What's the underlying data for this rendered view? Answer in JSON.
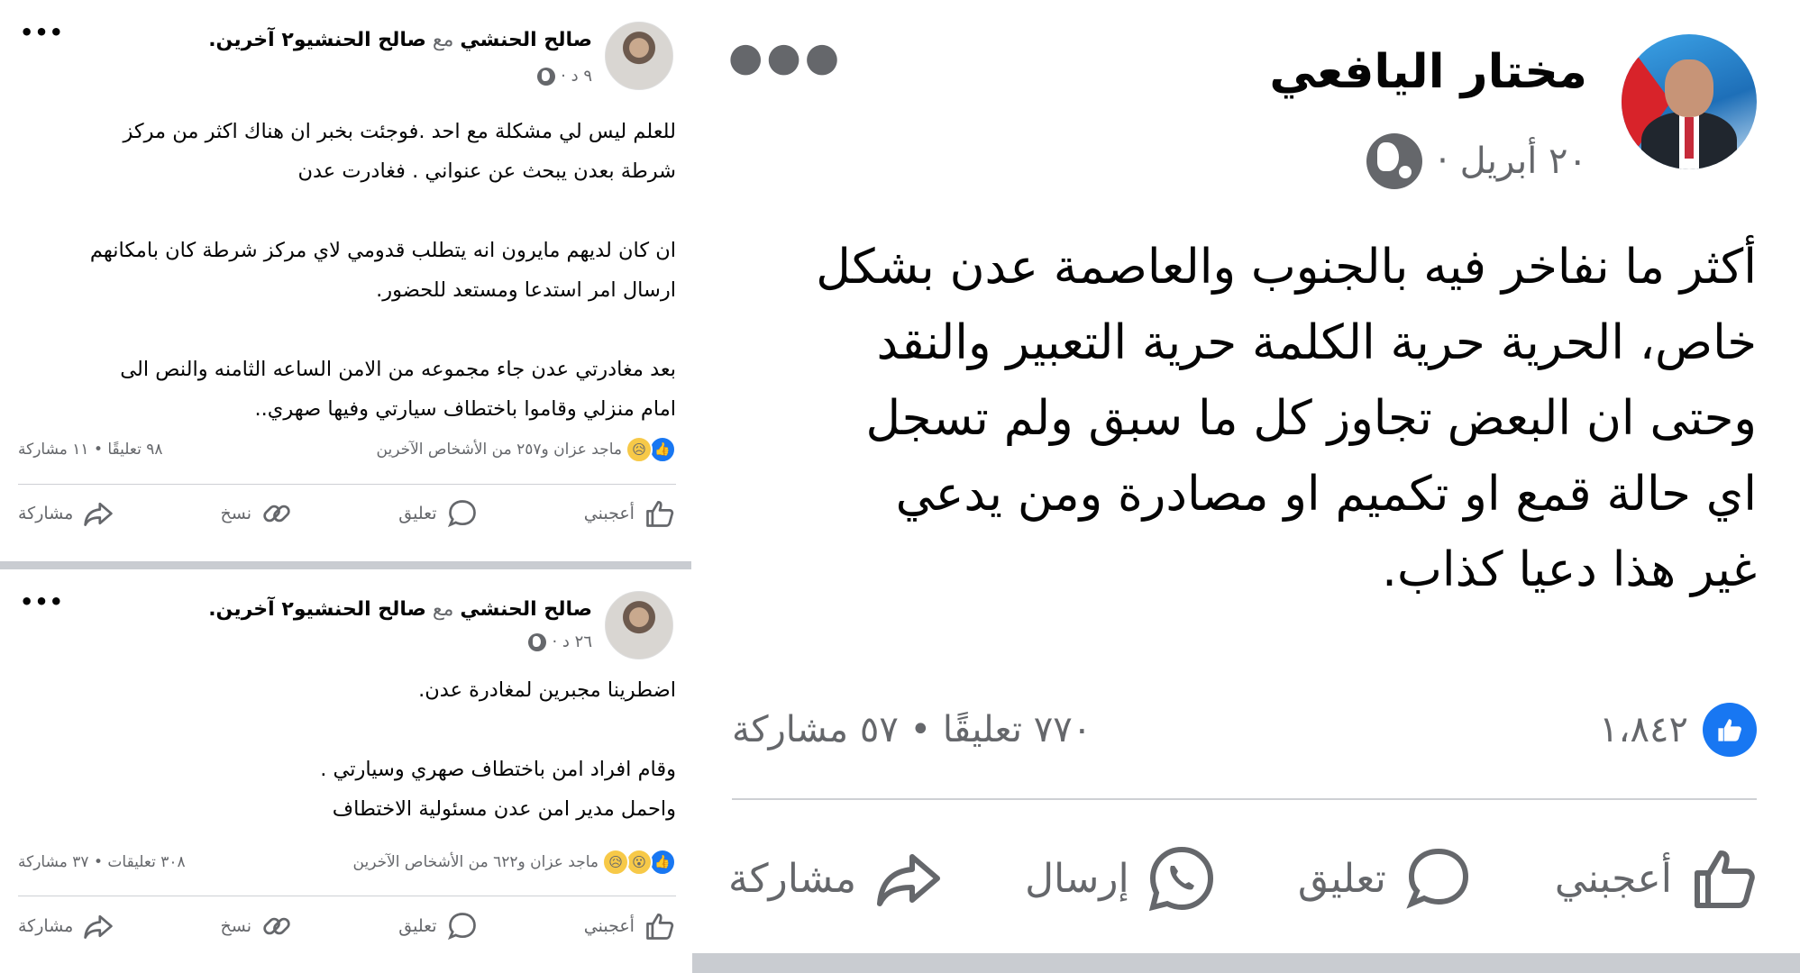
{
  "posts": [
    {
      "author": "صالح الحنشي",
      "with_word": "مع",
      "tagged": "صالح الحنشي",
      "and_others": "و٢ آخرين.",
      "time": "٩ د ·",
      "body": "للعلم ليس لي مشكلة مع احد .فوجئت بخبر ان هناك اكثر من مركز\nشرطة بعدن يبحث عن عنواني . فغادرت عدن\n\nان كان لديهم مايرون انه يتطلب قدومي لاي مركز شرطة كان بامكانهم\nارسال امر استدعا ومستعد للحضور.\n\nبعد مغادرتي عدن جاء مجموعه من الامن الساعه الثامنه والنص  الى\nامام منزلي وقاموا باختطاف سيارتي وفيها صهري..",
      "reactors": "ماجد عزان و٢٥٧ من الأشخاص الآخرين",
      "counts": "٩٨ تعليقًا • ١١ مشاركة",
      "actions": {
        "like": "أعجبني",
        "comment": "تعليق",
        "copy": "نسخ",
        "share": "مشاركة"
      }
    },
    {
      "author": "صالح الحنشي",
      "with_word": "مع",
      "tagged": "صالح الحنشي",
      "and_others": "و٢ آخرين.",
      "time": "٢٦ د ·",
      "body": "اضطرينا مجبرين لمغادرة عدن.\n\nوقام افراد امن باختطاف صهري وسيارتي .\nواحمل مدير امن عدن مسئولية الاختطاف",
      "reactors": "ماجد عزان و٦٢٢ من الأشخاص الآخرين",
      "counts": "٣٠٨ تعليقات • ٣٧ مشاركة",
      "actions": {
        "like": "أعجبني",
        "comment": "تعليق",
        "copy": "نسخ",
        "share": "مشاركة"
      }
    }
  ],
  "main_post": {
    "author": "مختار اليافعي",
    "date": "٢٠ أبريل ·",
    "body": "أكثر ما نفاخر فيه بالجنوب والعاصمة عدن بشكل\nخاص، الحرية حرية الكلمة حرية التعبير والنقد\nوحتى ان البعض تجاوز كل ما سبق ولم تسجل\nاي حالة قمع او تكميم او مصادرة ومن يدعي\nغير هذا دعيا كذاب.",
    "likes": "١،٨٤٢",
    "counts": "٧٧٠ تعليقًا • ٥٧ مشاركة",
    "actions": {
      "like": "أعجبني",
      "comment": "تعليق",
      "send": "إرسال",
      "share": "مشاركة"
    }
  },
  "icons": {
    "menu": "more-dots-icon",
    "globe": "globe-icon",
    "like": "thumbs-up-icon",
    "comment": "comment-bubble-icon",
    "copy": "link-icon",
    "share": "share-arrow-icon",
    "send": "whatsapp-icon"
  },
  "colors": {
    "facebook_blue": "#1877f2",
    "muted_text": "#65676b",
    "divider": "#ced0d4"
  }
}
